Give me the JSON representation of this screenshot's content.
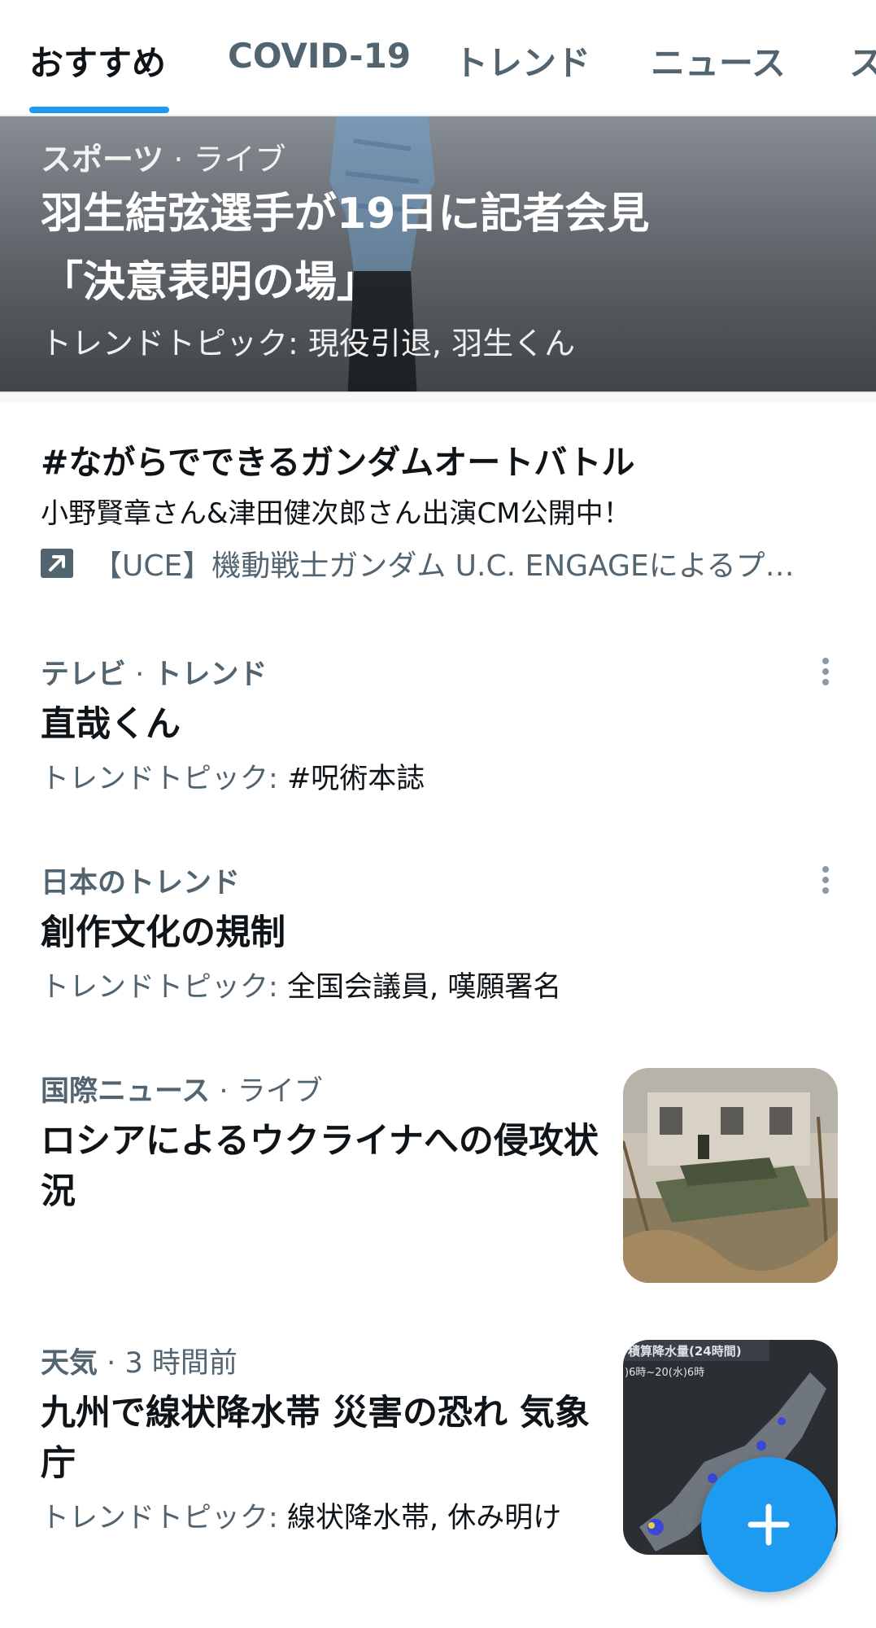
{
  "tabs": [
    {
      "label": "おすすめ",
      "active": true
    },
    {
      "label": "COVID-19",
      "active": false
    },
    {
      "label": "トレンド",
      "active": false
    },
    {
      "label": "ニュース",
      "active": false
    },
    {
      "label": "ス",
      "active": false
    }
  ],
  "hero": {
    "category": "スポーツ",
    "separator": "·",
    "status": "ライブ",
    "title_line1": "羽生結弦選手が19日に記者会見",
    "title_line2": "「決意表明の場」",
    "topics_label": "トレンドトピック:",
    "topics": "現役引退, 羽生くん"
  },
  "promoted": {
    "title": "#ながらでできるガンダムオートバトル",
    "description": "小野賢章さん&津田健次郎さん出演CM公開中！",
    "link_text": "【UCE】機動戦士ガンダム U.C. ENGAGEによるプ…",
    "link_icon": "external-link-arrow"
  },
  "trends": [
    {
      "category": "テレビ",
      "separator": "·",
      "status": "トレンド",
      "title": "直哉くん",
      "topics_label": "トレンドトピック:",
      "topics": "#呪術本誌"
    },
    {
      "category": "日本のトレンド",
      "title": "創作文化の規制",
      "topics_label": "トレンドトピック:",
      "topics": "全国会議員, 嘆願署名"
    },
    {
      "category": "国際ニュース",
      "separator": "·",
      "status": "ライブ",
      "title": "ロシアによるウクライナへの侵攻状況"
    },
    {
      "category": "天気",
      "separator": "·",
      "status": "3 時間前",
      "title": "九州で線状降水帯 災害の恐れ 気象庁",
      "topics_label": "トレンドトピック:",
      "topics": "線状降水帯, 休み明け"
    }
  ],
  "weather_thumb": {
    "header": "積算降水量(24時間)",
    "subheader": ")6時~20(水)6時"
  },
  "colors": {
    "accent": "#1d9bf0",
    "text_primary": "#0f1419",
    "text_secondary": "#536471"
  },
  "fab": {
    "icon": "plus-icon"
  }
}
